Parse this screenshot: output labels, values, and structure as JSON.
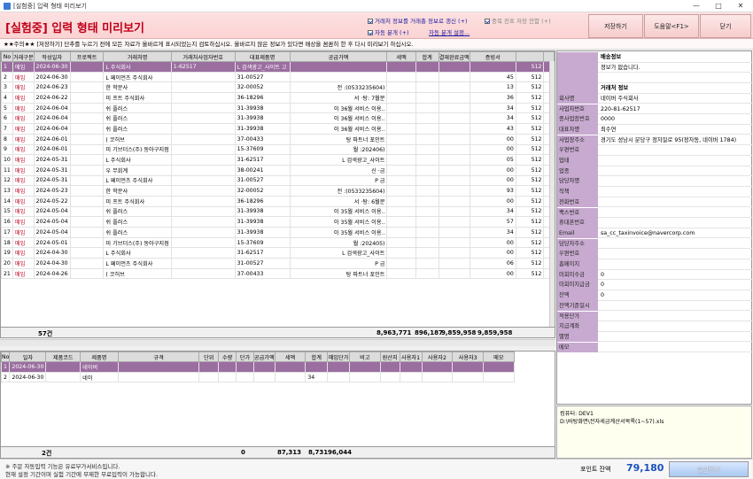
{
  "window": {
    "title": "[실험중] 입력 형태 미리보기",
    "minimize": "—",
    "maximize": "□",
    "close": "✕"
  },
  "header": {
    "title": "[실험중] 입력 형태 미리보기",
    "options": [
      {
        "label": "거래처 정보를 거래총 정보로 갱신 (+)",
        "checked": true
      },
      {
        "label": "중복 전표 저장 안함 (+)",
        "checked": true,
        "disabled": true
      },
      {
        "label": "자동 분개 (+)",
        "checked": true
      },
      {
        "label": "자동 분개 설정..."
      }
    ],
    "buttons": {
      "save": "저장하기",
      "help": "도움말<F1>",
      "close": "닫기"
    }
  },
  "notice": "★★주의★★ [저장하기] 단추를 누르기 전에 모든 자료가 올바르게 표시되었는지 검토하십시오. 올바르지 않은 정보가 있다면 매상을 꼼꼼히 한 후 다시 미리보기 하십시오.",
  "top_grid": {
    "columns": [
      "No",
      "거래구분",
      "작성일자",
      "프로젝트",
      "거래처명",
      "거래처사업자번호",
      "대표제품명",
      "공급가액",
      "세액",
      "합계",
      "결재완료금액",
      "증빙서",
      "",
      ""
    ],
    "rows": [
      [
        "1",
        "매입",
        "2024-06-30",
        "",
        "L    주식회사",
        "1-62517",
        "L    검색광고_사이트 고",
        "",
        "",
        "",
        "",
        "",
        "512",
        ""
      ],
      [
        "2",
        "매입",
        "2024-06-30",
        "",
        "L    페이먼츠 주식회사",
        "",
        "31-00527",
        "",
        "",
        "",
        "",
        "45",
        "512",
        ""
      ],
      [
        "3",
        "매입",
        "2024-06-23",
        "",
        "한    학문사",
        "",
        "32-00052",
        "전  :(0533235604)",
        "",
        "",
        "",
        "13",
        "512",
        ""
      ],
      [
        "4",
        "매입",
        "2024-06-22",
        "",
        "미    프트 주식회사",
        "",
        "36-18296",
        "서  ·탕: 7월분",
        "",
        "",
        "",
        "36",
        "512",
        ""
      ],
      [
        "5",
        "매입",
        "2024-06-04",
        "",
        "쉬    플러스",
        "",
        "31-39938",
        "이  36월 서비스 이용..",
        "",
        "",
        "",
        "34",
        "512",
        ""
      ],
      [
        "6",
        "매입",
        "2024-06-04",
        "",
        "쉬    플러스",
        "",
        "31-39938",
        "이  36월 서비스 이용..",
        "",
        "",
        "",
        "34",
        "512",
        ""
      ],
      [
        "7",
        "매입",
        "2024-06-04",
        "",
        "쉬    플러스",
        "",
        "31-39938",
        "이  36월 서비스 이용..",
        "",
        "",
        "",
        "43",
        "512",
        ""
      ],
      [
        "8",
        "매입",
        "2024-06-01",
        "",
        "(    코허브",
        "",
        "37-00433",
        "탕  파트너 포인트",
        "",
        "",
        "",
        "00",
        "512",
        ""
      ],
      [
        "9",
        "매입",
        "2024-06-01",
        "",
        "미    기브더스(주) 동아구지점",
        "",
        "15-37609",
        "월  :202406)",
        "",
        "",
        "",
        "00",
        "512",
        ""
      ],
      [
        "10",
        "매입",
        "2024-05-31",
        "",
        "L    주식회사",
        "",
        "31-62517",
        "L  검색광고_사이트",
        "",
        "",
        "",
        "05",
        "512",
        ""
      ],
      [
        "11",
        "매입",
        "2024-05-31",
        "",
        "우    무회계",
        "",
        "38-00241",
        "신  ·금",
        "",
        "",
        "",
        "00",
        "512",
        ""
      ],
      [
        "12",
        "매입",
        "2024-05-31",
        "",
        "L    페이먼츠 주식회사",
        "",
        "31-00527",
        "P  금",
        "",
        "",
        "",
        "00",
        "512",
        ""
      ],
      [
        "13",
        "매입",
        "2024-05-23",
        "",
        "한    학문사",
        "",
        "32-00052",
        "전  :(0533235604)",
        "",
        "",
        "",
        "93",
        "512",
        ""
      ],
      [
        "14",
        "매입",
        "2024-05-22",
        "",
        "미    프트 주식회사",
        "",
        "36-18296",
        "서  ·탕: 6월분",
        "",
        "",
        "",
        "00",
        "512",
        ""
      ],
      [
        "15",
        "매입",
        "2024-05-04",
        "",
        "쉬    플러스",
        "",
        "31-39938",
        "이  35월 서비스 이용..",
        "",
        "",
        "",
        "34",
        "512",
        ""
      ],
      [
        "16",
        "매입",
        "2024-05-04",
        "",
        "쉬    플러스",
        "",
        "31-39938",
        "이  35월 서비스 이용..",
        "",
        "",
        "",
        "57",
        "512",
        ""
      ],
      [
        "17",
        "매입",
        "2024-05-04",
        "",
        "쉬    플러스",
        "",
        "31-39938",
        "이  35월 서비스 이용..",
        "",
        "",
        "",
        "34",
        "512",
        ""
      ],
      [
        "18",
        "매입",
        "2024-05-01",
        "",
        "미    기브더스(주) 동아구지점",
        "",
        "15-37609",
        "월  :202405)",
        "",
        "",
        "",
        "00",
        "512",
        ""
      ],
      [
        "19",
        "매입",
        "2024-04-30",
        "",
        "L    주식회사",
        "",
        "31-62517",
        "L  검색광고_사이트",
        "",
        "",
        "",
        "00",
        "512",
        ""
      ],
      [
        "20",
        "매입",
        "2024-04-30",
        "",
        "L    페이먼츠 주식회사",
        "",
        "31-00527",
        "P  금",
        "",
        "",
        "",
        "06",
        "512",
        ""
      ],
      [
        "21",
        "매입",
        "2024-04-26",
        "",
        "(    코허브",
        "",
        "37-00433",
        "탕  파트너 포인트",
        "",
        "",
        "",
        "00",
        "512",
        ""
      ]
    ],
    "total": {
      "count": "57건",
      "supply": "8,963,771",
      "tax": "896,187",
      "sum": "9,859,958",
      "settled": "9,859,958"
    }
  },
  "bottom_grid": {
    "columns": [
      "No",
      "일자",
      "제품코드",
      "제품명",
      "규격",
      "단위",
      "수량",
      "단가",
      "공급가액",
      "세액",
      "합계",
      "매입단가",
      "비고",
      "원산지",
      "사용자1",
      "사용자2",
      "사용자3",
      "메모"
    ],
    "rows": [
      [
        "1",
        "2024-06-30",
        "",
        "네이버    ",
        "",
        "",
        "",
        "",
        "",
        "",
        "",
        "",
        "",
        "",
        "",
        "",
        "",
        ""
      ],
      [
        "2",
        "2024-06-30",
        "",
        "네이",
        "",
        "",
        "",
        "",
        "",
        "",
        "34",
        "",
        "",
        "",
        "",
        "",
        "",
        ""
      ]
    ],
    "total": {
      "count": "2건",
      "qty": "0",
      "supply": "87,313",
      "tax": "8,731",
      "sum": "96,044"
    }
  },
  "side_panel": {
    "rows": [
      {
        "key": "",
        "value": "배송정보",
        "header": true
      },
      {
        "key": "",
        "value": "정보가 없습니다."
      },
      {
        "key": "",
        "value": ""
      },
      {
        "key": "",
        "value": "거래처 정보",
        "header": true
      },
      {
        "key": "회사명",
        "value": "네이버 주식회사"
      },
      {
        "key": "사업자번호",
        "value": "220-81-62517"
      },
      {
        "key": "종사업장번호",
        "value": "0000"
      },
      {
        "key": "대표자명",
        "value": "최수연"
      },
      {
        "key": "사업장주소",
        "value": "경기도 성남시 분당구 정자일로 95(정자동, 네이버 1784)"
      },
      {
        "key": "우편번호",
        "value": ""
      },
      {
        "key": "업태",
        "value": ""
      },
      {
        "key": "업종",
        "value": ""
      },
      {
        "key": "담당자명",
        "value": ""
      },
      {
        "key": "직책",
        "value": ""
      },
      {
        "key": "전화번호",
        "value": ""
      },
      {
        "key": "팩스번호",
        "value": ""
      },
      {
        "key": "휴대폰번호",
        "value": ""
      },
      {
        "key": "Email",
        "value": "sa_cc_taxinvoice@navercorp.com"
      },
      {
        "key": "담당자주소",
        "value": ""
      },
      {
        "key": "우편번호",
        "value": ""
      },
      {
        "key": "홈페이지",
        "value": ""
      },
      {
        "key": "미회미수금",
        "value": "0"
      },
      {
        "key": "미회미지급금",
        "value": "0"
      },
      {
        "key": "잔액",
        "value": "0"
      },
      {
        "key": "잔액기준일시",
        "value": ""
      },
      {
        "key": "적용단가",
        "value": ""
      },
      {
        "key": "지급계좌",
        "value": ""
      },
      {
        "key": "별명",
        "value": ""
      },
      {
        "key": "메모",
        "value": ""
      }
    ],
    "memo": [
      "컴퓨터: DEV1",
      "D:\\바탕화면\\전자세금계산서목록(1~57).xls"
    ]
  },
  "footer": {
    "line1": "※ 주문 자동입력 기능은 유료부가서비스입니다.",
    "line2": "현재 설정 기간이며 실험 기간에 무제한 무료입력이 가능합니다.",
    "point_label": "포인트 잔액",
    "point_value": "79,180",
    "out_button": "출견하기"
  },
  "colors": {
    "accent": "#c00018",
    "selected_row": "#9b6ea0",
    "side_key_bg": "#c8aad0"
  }
}
